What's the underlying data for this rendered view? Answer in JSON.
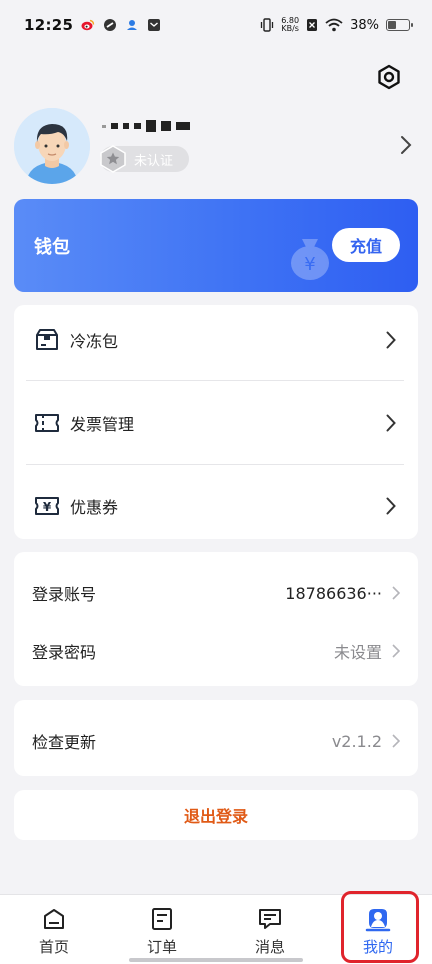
{
  "status_bar": {
    "time": "12:25",
    "net_speed_value": "6.80",
    "net_speed_unit": "KB/s",
    "battery": "38%",
    "battery_level": 0.38,
    "icons": [
      "weibo-icon",
      "link-icon",
      "app-icon",
      "message-icon",
      "vibrate-icon",
      "sim-off-icon",
      "wifi-icon",
      "battery-icon"
    ]
  },
  "header": {
    "settings_icon": "gear-icon"
  },
  "profile": {
    "certification": "未认证",
    "badge_icon": "shield-star-icon"
  },
  "wallet": {
    "title": "钱包",
    "recharge_label": "充值",
    "color_start": "#5a8cf7",
    "color_end": "#2e5ef2"
  },
  "menu": {
    "items": [
      {
        "label": "冷冻包",
        "icon": "cold-pack-icon"
      },
      {
        "label": "发票管理",
        "icon": "invoice-icon"
      },
      {
        "label": "优惠券",
        "icon": "coupon-icon"
      }
    ]
  },
  "account": {
    "login_account_label": "登录账号",
    "login_account_value": "18786636···",
    "login_password_label": "登录密码",
    "login_password_value": "未设置"
  },
  "update": {
    "label": "检查更新",
    "version": "v2.1.2"
  },
  "logout": {
    "label": "退出登录",
    "color": "#e05a16"
  },
  "bottom_nav": {
    "items": [
      {
        "label": "首页",
        "icon": "home-icon"
      },
      {
        "label": "订单",
        "icon": "order-icon"
      },
      {
        "label": "消息",
        "icon": "message-icon"
      },
      {
        "label": "我的",
        "icon": "profile-icon",
        "active": true
      }
    ],
    "active_color": "#2f68f0",
    "highlight_color": "#e0242c"
  }
}
